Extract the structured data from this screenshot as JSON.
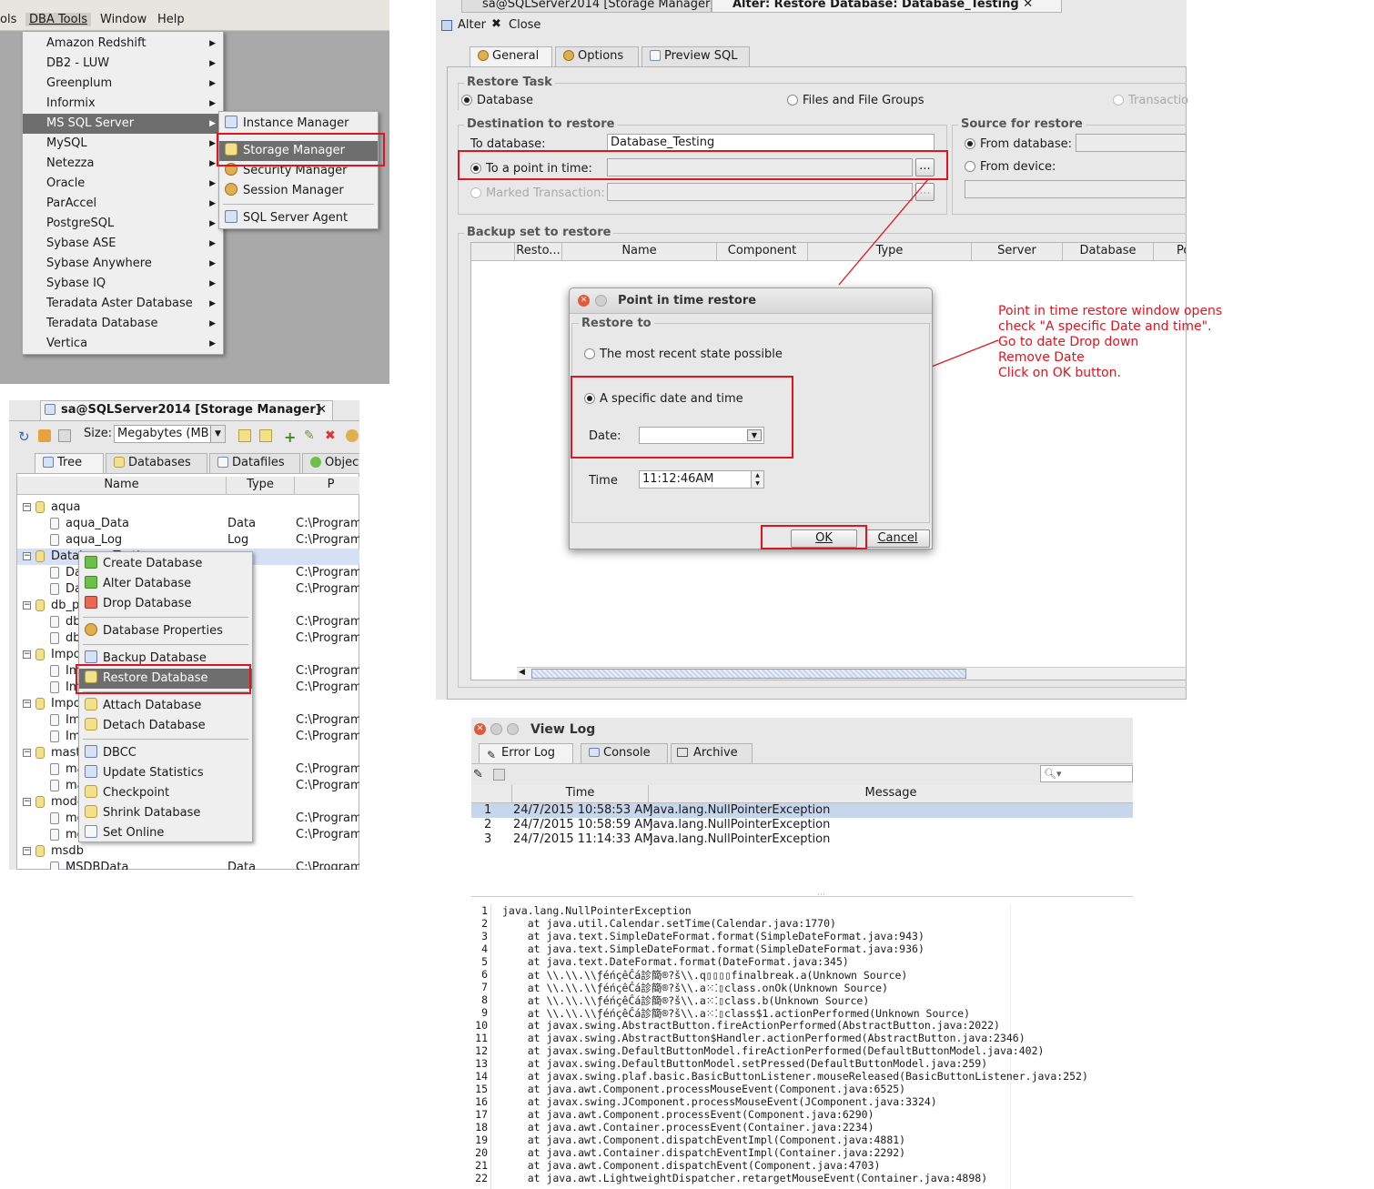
{
  "menubar": {
    "items": [
      "ols",
      "DBA Tools",
      "Window",
      "Help"
    ]
  },
  "dba_menu": {
    "items": [
      {
        "label": "Amazon Redshift"
      },
      {
        "label": "DB2 - LUW"
      },
      {
        "label": "Greenplum"
      },
      {
        "label": "Informix"
      },
      {
        "label": "MS SQL Server"
      },
      {
        "label": "MySQL"
      },
      {
        "label": "Netezza"
      },
      {
        "label": "Oracle"
      },
      {
        "label": "ParAccel"
      },
      {
        "label": "PostgreSQL"
      },
      {
        "label": "Sybase ASE"
      },
      {
        "label": "Sybase Anywhere"
      },
      {
        "label": "Sybase IQ"
      },
      {
        "label": "Teradata Aster Database"
      },
      {
        "label": "Teradata Database"
      },
      {
        "label": "Vertica"
      }
    ],
    "selected": "MS SQL Server"
  },
  "sql_submenu": {
    "items": [
      "Instance Manager",
      "Storage Manager",
      "Security Manager",
      "Session Manager",
      "SQL Server Agent"
    ],
    "selected": "Storage Manager"
  },
  "storage_manager": {
    "tab_title": "sa@SQLServer2014 [Storage Manager]",
    "size_label": "Size:",
    "size_value": "Megabytes (MB)",
    "subtabs": [
      "Tree",
      "Databases",
      "Datafiles",
      "Objec"
    ],
    "columns": [
      "Name",
      "Type",
      "P"
    ],
    "rows": [
      {
        "name": "aqua",
        "type": "",
        "path": ""
      },
      {
        "name": "aqua_Data",
        "type": "Data",
        "path": "C:\\Program"
      },
      {
        "name": "aqua_Log",
        "type": "Log",
        "path": "C:\\Program"
      },
      {
        "name": "Database_Testing",
        "type": "",
        "path": ""
      },
      {
        "name": "Da",
        "type": "",
        "path": "C:\\Program"
      },
      {
        "name": "Da",
        "type": "",
        "path": "C:\\Program"
      },
      {
        "name": "db_p",
        "type": "",
        "path": ""
      },
      {
        "name": "db",
        "type": "",
        "path": "C:\\Program"
      },
      {
        "name": "db",
        "type": "",
        "path": "C:\\Program"
      },
      {
        "name": "Impo",
        "type": "",
        "path": ""
      },
      {
        "name": "Im",
        "type": "",
        "path": "C:\\Program"
      },
      {
        "name": "Im",
        "type": "",
        "path": "C:\\Program"
      },
      {
        "name": "Impo",
        "type": "",
        "path": ""
      },
      {
        "name": "Im",
        "type": "",
        "path": "C:\\Program"
      },
      {
        "name": "Im",
        "type": "",
        "path": "C:\\Program"
      },
      {
        "name": "mast",
        "type": "",
        "path": ""
      },
      {
        "name": "ma",
        "type": "",
        "path": "C:\\Program"
      },
      {
        "name": "ma",
        "type": "",
        "path": "C:\\Program"
      },
      {
        "name": "mode",
        "type": "",
        "path": ""
      },
      {
        "name": "mo",
        "type": "",
        "path": "C:\\Program"
      },
      {
        "name": "mo",
        "type": "",
        "path": "C:\\Program"
      },
      {
        "name": "msdb",
        "type": "",
        "path": ""
      },
      {
        "name": "MSDBData",
        "type": "Data",
        "path": "C:\\Program"
      }
    ]
  },
  "context_menu": {
    "items": [
      "Create Database",
      "Alter Database",
      "Drop Database",
      "Database Properties",
      "Backup Database",
      "Restore Database",
      "Attach Database",
      "Detach Database",
      "DBCC",
      "Update Statistics",
      "Checkpoint",
      "Shrink Database",
      "Set Online"
    ],
    "selected": "Restore Database"
  },
  "restore": {
    "tab_inactive": "sa@SQLServer2014 [Storage Manager]",
    "tab_active": "Alter: Restore Database: Database_Testing",
    "toolbar": {
      "alter": "Alter",
      "close": "Close"
    },
    "tabs": [
      "General",
      "Options",
      "Preview SQL"
    ],
    "restore_task": {
      "title": "Restore Task",
      "options": [
        "Database",
        "Files and File Groups",
        "Transactio"
      ]
    },
    "destination": {
      "title": "Destination to restore",
      "to_database_label": "To database:",
      "to_database_value": "Database_Testing",
      "point_in_time_label": "To a point in time:",
      "marked_label": "Marked Transaction:",
      "browse": "..."
    },
    "source": {
      "title": "Source for restore",
      "from_database": "From database:",
      "from_device": "From device:"
    },
    "backup_set": {
      "title": "Backup set to restore",
      "columns": [
        "Resto...",
        "Name",
        "Component",
        "Type",
        "Server",
        "Database",
        "Po"
      ]
    }
  },
  "pit_dialog": {
    "title": "Point in time restore",
    "group_title": "Restore to",
    "option_recent": "The most recent state possible",
    "option_specific": "A specific date and time",
    "date_label": "Date:",
    "time_label": "Time",
    "time_value": "11:12:46AM",
    "ok": "OK",
    "cancel": "Cancel"
  },
  "annotation": {
    "lines": [
      "Point in time restore window opens",
      "check \"A specific Date and time\".",
      "Go to date Drop down",
      "Remove Date",
      "Click on OK button."
    ]
  },
  "view_log": {
    "title": "View Log",
    "tabs": [
      "Error Log",
      "Console",
      "Archive"
    ],
    "columns": [
      "Time",
      "Message"
    ],
    "rows": [
      {
        "n": "1",
        "time": "24/7/2015 10:58:53 AM",
        "msg": "java.lang.NullPointerException"
      },
      {
        "n": "2",
        "time": "24/7/2015 10:58:59 AM",
        "msg": "java.lang.NullPointerException"
      },
      {
        "n": "3",
        "time": "24/7/2015 11:14:33 AM",
        "msg": "java.lang.NullPointerException"
      }
    ],
    "stack": [
      "java.lang.NullPointerException",
      "    at java.util.Calendar.setTime(Calendar.java:1770)",
      "    at java.text.SimpleDateFormat.format(SimpleDateFormat.java:943)",
      "    at java.text.SimpleDateFormat.format(SimpleDateFormat.java:936)",
      "    at java.text.DateFormat.format(DateFormat.java:345)",
      "    at \\\\.\\\\.\\\\ƒéńçêĈá診簡®?š\\\\.q▯▯▯▯finalbreak.a(Unknown Source)",
      "    at \\\\.\\\\.\\\\ƒéńçêĈá診簡®?š\\\\.a⁙⁚▯class.onOk(Unknown Source)",
      "    at \\\\.\\\\.\\\\ƒéńçêĈá診簡®?š\\\\.a⁙⁚▯class.b(Unknown Source)",
      "    at \\\\.\\\\.\\\\ƒéńçêĈá診簡®?š\\\\.a⁙⁚▯class$1.actionPerformed(Unknown Source)",
      "    at javax.swing.AbstractButton.fireActionPerformed(AbstractButton.java:2022)",
      "    at javax.swing.AbstractButton$Handler.actionPerformed(AbstractButton.java:2346)",
      "    at javax.swing.DefaultButtonModel.fireActionPerformed(DefaultButtonModel.java:402)",
      "    at javax.swing.DefaultButtonModel.setPressed(DefaultButtonModel.java:259)",
      "    at javax.swing.plaf.basic.BasicButtonListener.mouseReleased(BasicButtonListener.java:252)",
      "    at java.awt.Component.processMouseEvent(Component.java:6525)",
      "    at javax.swing.JComponent.processMouseEvent(JComponent.java:3324)",
      "    at java.awt.Component.processEvent(Component.java:6290)",
      "    at java.awt.Container.processEvent(Container.java:2234)",
      "    at java.awt.Component.dispatchEventImpl(Component.java:4881)",
      "    at java.awt.Container.dispatchEventImpl(Container.java:2292)",
      "    at java.awt.Component.dispatchEvent(Component.java:4703)",
      "    at java.awt.LightweightDispatcher.retargetMouseEvent(Container.java:4898)"
    ]
  }
}
